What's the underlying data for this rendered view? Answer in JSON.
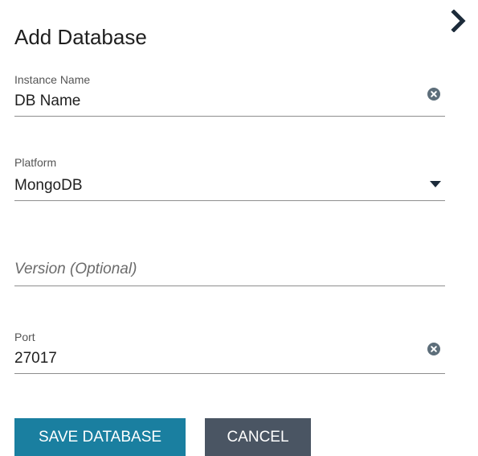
{
  "panel": {
    "title": "Add Database",
    "collapse_icon": "chevron-right-icon"
  },
  "fields": {
    "instance_name": {
      "label": "Instance Name",
      "value": "DB Name",
      "action_icon": "clear-icon"
    },
    "platform": {
      "label": "Platform",
      "value": "MongoDB",
      "action_icon": "caret-down-icon"
    },
    "version": {
      "placeholder": "Version (Optional)",
      "value": ""
    },
    "port": {
      "label": "Port",
      "value": "27017",
      "action_icon": "clear-icon"
    }
  },
  "actions": {
    "save_label": "SAVE DATABASE",
    "cancel_label": "CANCEL"
  },
  "colors": {
    "primary": "#1a7fa0",
    "secondary": "#4a5563",
    "icon": "#5d6e7a",
    "text": "#1f1f1f"
  }
}
